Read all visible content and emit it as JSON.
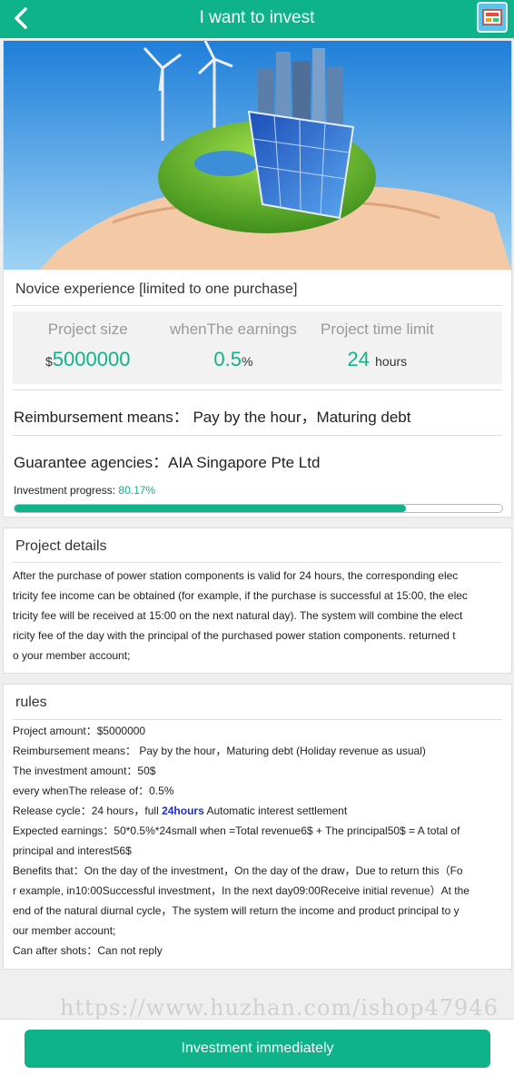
{
  "header": {
    "title": "I want to invest",
    "back_icon": "chevron-left-icon",
    "corner_icon": "app-icon"
  },
  "project": {
    "name": "Novice experience [limited to one purchase]",
    "size_label": "Project size",
    "size_currency": "$",
    "size_value": "5000000",
    "earnings_label": "whenThe earnings",
    "earnings_value": "0.5",
    "earnings_unit": "%",
    "time_label": "Project time limit",
    "time_value": "24",
    "time_unit": "hours",
    "reimbursement": "Reimbursement means：  Pay by the hour，Maturing debt",
    "guarantee": "Guarantee agencies：AIA Singapore Pte Ltd",
    "progress_label": "Investment progress:",
    "progress_text": "80.17%",
    "progress_fraction": 0.8017
  },
  "details": {
    "title": "Project details",
    "lines": [
      "After the purchase of power station components is valid for 24 hours, the corresponding elec",
      "tricity fee income can be obtained (for example, if the purchase is successful at 15:00, the elec",
      "tricity fee will be received at 15:00 on the next natural day). The system will combine the elect",
      "ricity fee of the day with the principal of the purchased power station components. returned t",
      "o your member account;"
    ]
  },
  "rules": {
    "title": "rules",
    "line1": "Project amount：$5000000",
    "line2": "Reimbursement means：  Pay by the hour，Maturing debt   (Holiday revenue as usual)",
    "line3": "The investment amount：50$",
    "line4": "every whenThe release of：0.5%",
    "line5_pre": "Release cycle：24  hours，full ",
    "line5_bold": "24hours",
    "line5_post": " Automatic interest settlement",
    "line6": "Expected earnings：50*0.5%*24small when =Total revenue6$ + The principal50$ = A total of",
    "line7": "principal and interest56$",
    "line8": "Benefits that：On the day of the investment，On the day of the draw，Due to return this（Fo",
    "line9": "r example, in10:00Successful investment，In the next day09:00Receive initial revenue）At the",
    "line10": "end of the natural diurnal cycle，The system will return the income and product principal to y",
    "line11": "our member account;",
    "line12": "Can after shots：Can not reply"
  },
  "watermark": "https://www.huzhan.com/ishop47946",
  "cta": {
    "label": "Investment immediately"
  },
  "colors": {
    "accent": "#0fb389",
    "highlight": "#1b2fd6"
  }
}
